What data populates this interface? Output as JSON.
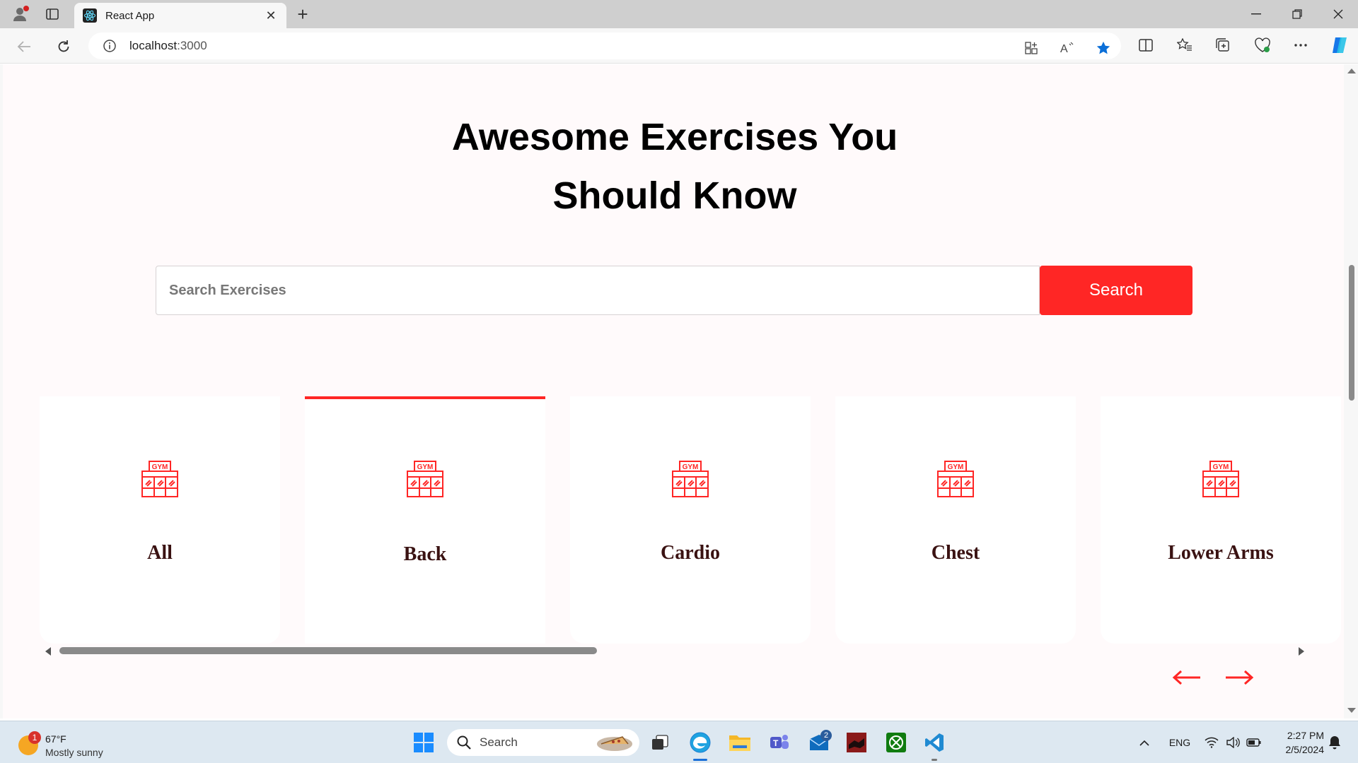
{
  "browser": {
    "tab_title": "React App",
    "url_host": "localhost",
    "url_port": ":3000"
  },
  "page": {
    "heading_line1": "Awesome Exercises You",
    "heading_line2": "Should Know",
    "search": {
      "placeholder": "Search Exercises",
      "value": "",
      "button_label": "Search"
    },
    "categories": [
      {
        "label": "All",
        "icon": "gym-icon",
        "active": false
      },
      {
        "label": "Back",
        "icon": "gym-icon",
        "active": true
      },
      {
        "label": "Cardio",
        "icon": "gym-icon",
        "active": false
      },
      {
        "label": "Chest",
        "icon": "gym-icon",
        "active": false
      },
      {
        "label": "Lower Arms",
        "icon": "gym-icon",
        "active": false
      }
    ],
    "accent_color": "#ff2625",
    "background_color": "#fffafb",
    "card_label_color": "#3a1212"
  },
  "taskbar": {
    "weather": {
      "temp": "67°F",
      "desc": "Mostly sunny",
      "badge": "1"
    },
    "search_label": "Search",
    "mail_badge": "2",
    "language": "ENG",
    "time": "2:27 PM",
    "date": "2/5/2024"
  }
}
